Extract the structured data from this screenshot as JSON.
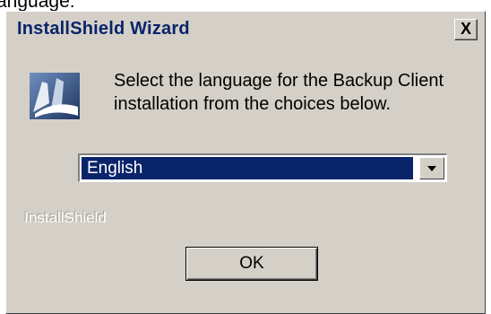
{
  "background": {
    "partial_text": "anguage:"
  },
  "window": {
    "title": "InstallShield Wizard",
    "close_label": "X"
  },
  "content": {
    "message": "Select the language for the Backup Client installation from the choices below.",
    "icon": "installshield-icon"
  },
  "language_select": {
    "selected": "English"
  },
  "brand": "InstallShield",
  "ok_button": "OK",
  "colors": {
    "dialog_face": "#d4d0c8",
    "selection": "#0a246a",
    "title_text": "#0a246a"
  }
}
